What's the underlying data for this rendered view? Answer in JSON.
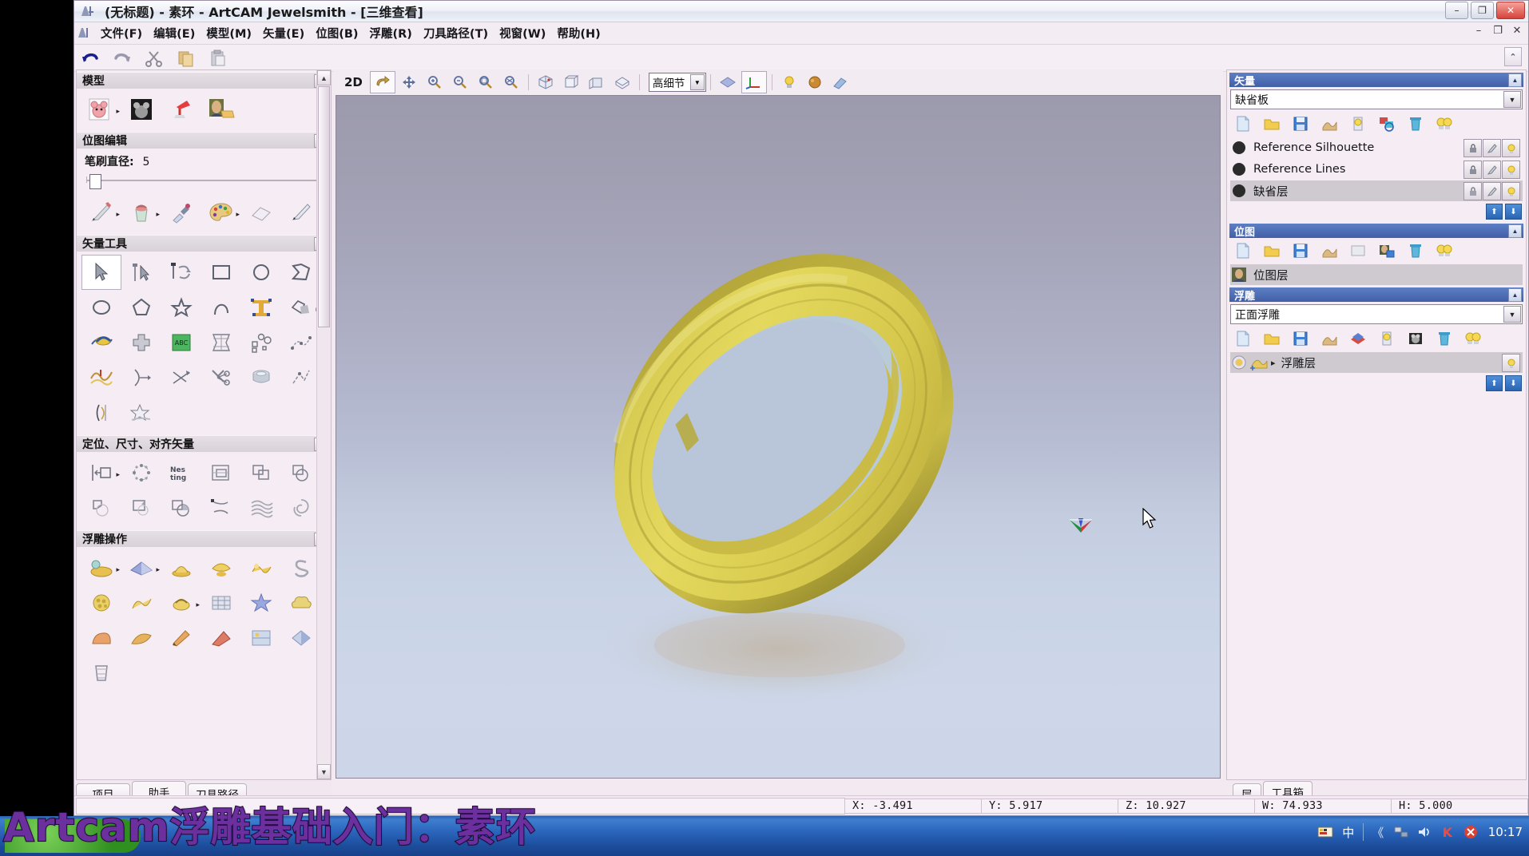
{
  "window": {
    "title": "(无标题) - 素环 - ArtCAM Jewelsmith - [三维查看]",
    "minimize_label": "–",
    "restore_label": "❐",
    "close_label": "✕",
    "mdi_minimize": "–",
    "mdi_restore": "❐",
    "mdi_close": "✕"
  },
  "menu": {
    "items": [
      {
        "label": "文件(F)",
        "name": "menu-file"
      },
      {
        "label": "编辑(E)",
        "name": "menu-edit"
      },
      {
        "label": "模型(M)",
        "name": "menu-model"
      },
      {
        "label": "矢量(E)",
        "name": "menu-vector"
      },
      {
        "label": "位图(B)",
        "name": "menu-bitmap"
      },
      {
        "label": "浮雕(R)",
        "name": "menu-relief"
      },
      {
        "label": "刀具路径(T)",
        "name": "menu-toolpath"
      },
      {
        "label": "视窗(W)",
        "name": "menu-window"
      },
      {
        "label": "帮助(H)",
        "name": "menu-help"
      }
    ]
  },
  "main_toolbar": {
    "items": [
      {
        "name": "undo-icon",
        "glyph": "↶"
      },
      {
        "name": "redo-icon",
        "glyph": "↷"
      },
      {
        "name": "cut-scissors-icon",
        "glyph": "✂"
      },
      {
        "name": "copy-icon",
        "glyph": "❏"
      },
      {
        "name": "paste-icon",
        "glyph": "📋"
      }
    ],
    "collapse_label": "⌃"
  },
  "left_dock": {
    "sections": [
      {
        "title": "模型",
        "name": "section-model",
        "chevron": "▲",
        "tools": [
          {
            "name": "tool-new-model-from-image",
            "glyph": "🧸",
            "has_arrow": true
          },
          {
            "name": "tool-grayscale-model",
            "glyph": "▦",
            "has_arrow": false
          },
          {
            "name": "tool-lamp-light-setup",
            "glyph": "💡",
            "has_arrow": false
          },
          {
            "name": "tool-image-to-relief",
            "glyph": "🖼",
            "has_arrow": false
          }
        ]
      },
      {
        "title": "位图编辑",
        "name": "section-bitmap-edit",
        "chevron": "▲",
        "brush_label": "笔刷直径:",
        "brush_value": "5",
        "tools": [
          {
            "name": "tool-pencil",
            "glyph": "✎",
            "has_arrow": true
          },
          {
            "name": "tool-paint-bucket",
            "glyph": "🪣",
            "has_arrow": true
          },
          {
            "name": "tool-eyedropper",
            "glyph": "💉",
            "has_arrow": false
          },
          {
            "name": "tool-color-palette",
            "glyph": "🎨",
            "has_arrow": true
          },
          {
            "name": "tool-eraser",
            "glyph": "⬭",
            "has_arrow": false
          },
          {
            "name": "tool-pen-draw",
            "glyph": "🖊",
            "has_arrow": false
          }
        ]
      },
      {
        "title": "矢量工具",
        "name": "section-vector-tools",
        "chevron": "▲",
        "tools": [
          {
            "name": "tool-select-arrow",
            "glyph": "➤",
            "selected": true
          },
          {
            "name": "tool-node-edit",
            "glyph": "⤢",
            "has_arrow": false
          },
          {
            "name": "tool-transform",
            "glyph": "✥",
            "has_arrow": false
          },
          {
            "name": "tool-rectangle",
            "glyph": "▭",
            "has_arrow": false
          },
          {
            "name": "tool-ellipse",
            "glyph": "◯",
            "has_arrow": false
          },
          {
            "name": "tool-polyline",
            "glyph": "⌁",
            "has_arrow": false
          },
          {
            "name": "tool-circle",
            "glyph": "◯",
            "has_arrow": false
          },
          {
            "name": "tool-polygon",
            "glyph": "⬠",
            "has_arrow": false
          },
          {
            "name": "tool-star",
            "glyph": "☆",
            "has_arrow": false
          },
          {
            "name": "tool-arc",
            "glyph": "◠",
            "has_arrow": false
          },
          {
            "name": "tool-text",
            "glyph": "T",
            "has_arrow": false
          },
          {
            "name": "tool-vector-merge",
            "glyph": "◣",
            "has_arrow": true
          },
          {
            "name": "tool-text-on-curve",
            "glyph": "〰",
            "has_arrow": false
          },
          {
            "name": "tool-vector-doctor",
            "glyph": "✚",
            "has_arrow": false
          },
          {
            "name": "tool-abc-texture",
            "glyph": "ABC",
            "has_arrow": false
          },
          {
            "name": "tool-distort",
            "glyph": "▤",
            "has_arrow": false
          },
          {
            "name": "tool-nest-shapes",
            "glyph": "⁘",
            "has_arrow": false
          },
          {
            "name": "tool-fit-curve",
            "glyph": "⋰",
            "has_arrow": false
          },
          {
            "name": "tool-vector-smooth",
            "glyph": "〽",
            "has_arrow": false
          },
          {
            "name": "tool-offset-vector",
            "glyph": ")-",
            "has_arrow": false
          },
          {
            "name": "tool-measure",
            "glyph": "〉",
            "has_arrow": false
          },
          {
            "name": "tool-trim-vectors",
            "glyph": "✂",
            "has_arrow": false
          },
          {
            "name": "tool-extrude-ring",
            "glyph": "⬯",
            "has_arrow": false
          },
          {
            "name": "tool-connect-vectors",
            "glyph": "⋋",
            "has_arrow": false
          },
          {
            "name": "tool-ring-sizer",
            "glyph": "◖",
            "has_arrow": false
          },
          {
            "name": "tool-star-cluster",
            "glyph": "✦",
            "has_arrow": false
          }
        ]
      },
      {
        "title": "定位、尺寸、对齐矢量",
        "name": "section-position-size-align",
        "chevron": "▲",
        "tools": [
          {
            "name": "tool-align-left",
            "glyph": "⊢▢",
            "has_arrow": true
          },
          {
            "name": "tool-circular-array",
            "glyph": "◌",
            "has_arrow": false
          },
          {
            "name": "tool-nesting",
            "glyph": "Nesting",
            "has_arrow": false
          },
          {
            "name": "tool-block-copy",
            "glyph": "⊞",
            "has_arrow": false
          },
          {
            "name": "tool-group-vectors",
            "glyph": "❐",
            "has_arrow": false
          },
          {
            "name": "tool-weld-vectors",
            "glyph": "◔",
            "has_arrow": false
          },
          {
            "name": "tool-subtract-vectors",
            "glyph": "◑",
            "has_arrow": false
          },
          {
            "name": "tool-intersect-vectors",
            "glyph": "◪",
            "has_arrow": false
          },
          {
            "name": "tool-combine-vectors",
            "glyph": "◕",
            "has_arrow": false
          },
          {
            "name": "tool-curve-fit",
            "glyph": "〜",
            "has_arrow": false
          },
          {
            "name": "tool-wave-pattern",
            "glyph": "≋",
            "has_arrow": false
          },
          {
            "name": "tool-spiral-pattern",
            "glyph": "◎",
            "has_arrow": false
          }
        ]
      },
      {
        "title": "浮雕操作",
        "name": "section-relief-operations",
        "chevron": "▲",
        "tools": [
          {
            "name": "tool-relief-paste",
            "glyph": "🪄",
            "has_arrow": true
          },
          {
            "name": "tool-relief-plane",
            "glyph": "◆",
            "has_arrow": true
          },
          {
            "name": "tool-relief-shape-editor",
            "glyph": "⛰",
            "has_arrow": false
          },
          {
            "name": "tool-relief-dome",
            "glyph": "🍄",
            "has_arrow": false
          },
          {
            "name": "tool-relief-sculpt",
            "glyph": "✿",
            "has_arrow": false
          },
          {
            "name": "tool-relief-smooth-s",
            "glyph": "S",
            "has_arrow": false
          },
          {
            "name": "tool-relief-texture",
            "glyph": "◍",
            "has_arrow": false
          },
          {
            "name": "tool-relief-extrude",
            "glyph": "⌒",
            "has_arrow": false
          },
          {
            "name": "tool-relief-spin",
            "glyph": "⊙",
            "has_arrow": true
          },
          {
            "name": "tool-relief-weave",
            "glyph": "▣",
            "has_arrow": false
          },
          {
            "name": "tool-relief-star",
            "glyph": "✶",
            "has_arrow": false
          },
          {
            "name": "tool-relief-cloud",
            "glyph": "☁",
            "has_arrow": false
          },
          {
            "name": "tool-relief-fillet",
            "glyph": "◗",
            "has_arrow": false
          },
          {
            "name": "tool-relief-blend",
            "glyph": "◠",
            "has_arrow": false
          },
          {
            "name": "tool-relief-knife",
            "glyph": "🔪",
            "has_arrow": false
          },
          {
            "name": "tool-relief-slice",
            "glyph": "◢",
            "has_arrow": false
          },
          {
            "name": "tool-relief-layers",
            "glyph": "▧",
            "has_arrow": false
          },
          {
            "name": "tool-relief-flip",
            "glyph": "◇",
            "has_arrow": false
          },
          {
            "name": "tool-relief-column",
            "glyph": "⌸",
            "has_arrow": false
          }
        ]
      }
    ],
    "tabs": [
      {
        "label": "项目",
        "name": "tab-project",
        "active": false
      },
      {
        "label": "助手",
        "name": "tab-assistant",
        "active": true
      },
      {
        "label": "刀具路径",
        "name": "tab-toolpath",
        "active": false
      }
    ]
  },
  "viewport_toolbar": {
    "mode_button": "2D",
    "items": [
      {
        "name": "rotate-view-icon",
        "glyph": "↻",
        "selected": true
      },
      {
        "name": "pan-view-icon",
        "glyph": "✥"
      },
      {
        "name": "zoom-in-icon",
        "glyph": "🔍"
      },
      {
        "name": "zoom-out-icon",
        "glyph": "🔍"
      },
      {
        "name": "zoom-window-icon",
        "glyph": "🔍"
      },
      {
        "name": "zoom-fit-icon",
        "glyph": "🔍"
      },
      {
        "name": "iso-view-icon",
        "glyph": "⬡"
      },
      {
        "name": "front-view-icon",
        "glyph": "▢"
      },
      {
        "name": "side-view-icon",
        "glyph": "▢"
      },
      {
        "name": "top-view-icon",
        "glyph": "▱"
      }
    ],
    "detail_value": "高细节",
    "detail_arrow": "▼",
    "right_items": [
      {
        "name": "shade-relief-icon",
        "glyph": "◆"
      },
      {
        "name": "show-axes-icon",
        "glyph": "⊥",
        "selected": true
      },
      {
        "name": "lighting-icon",
        "glyph": "💡"
      },
      {
        "name": "material-icon",
        "glyph": "🟠"
      },
      {
        "name": "clear-view-icon",
        "glyph": "🧹"
      }
    ]
  },
  "viewport": {
    "model_name": "素环",
    "cursor_name": "mouse-pointer",
    "gizmo_name": "axis-gizmo"
  },
  "right_dock": {
    "panels": [
      {
        "title": "矢量",
        "name": "panel-vector",
        "chevron": "▲",
        "combo_value": "缺省板",
        "combo_arrow": "▼",
        "tools": [
          {
            "name": "new-layer-icon",
            "glyph": "📄"
          },
          {
            "name": "open-layer-icon",
            "glyph": "📂"
          },
          {
            "name": "save-layer-icon",
            "glyph": "💾"
          },
          {
            "name": "duplicate-layer-icon",
            "glyph": "🗂"
          },
          {
            "name": "layer-visibility-icon",
            "glyph": "💡"
          },
          {
            "name": "merge-layer-icon",
            "glyph": "🔀"
          },
          {
            "name": "delete-layer-icon",
            "glyph": "🗑"
          },
          {
            "name": "show-all-layers-icon",
            "glyph": "💡"
          }
        ],
        "layers": [
          {
            "label": "Reference Silhouette",
            "name": "layer-reference-silhouette",
            "selected": false
          },
          {
            "label": "Reference Lines",
            "name": "layer-reference-lines",
            "selected": false
          },
          {
            "label": "缺省层",
            "name": "layer-default",
            "selected": true
          }
        ],
        "move_up": "⬆",
        "move_down": "⬇"
      },
      {
        "title": "位图",
        "name": "panel-bitmap",
        "chevron": "▲",
        "tools": [
          {
            "name": "new-bitmap-icon",
            "glyph": "📄"
          },
          {
            "name": "open-bitmap-icon",
            "glyph": "📂"
          },
          {
            "name": "save-bitmap-icon",
            "glyph": "💾"
          },
          {
            "name": "duplicate-bitmap-icon",
            "glyph": "🗂"
          },
          {
            "name": "blank-bitmap-icon",
            "glyph": "▭"
          },
          {
            "name": "bitmap-to-vector-icon",
            "glyph": "🖼"
          },
          {
            "name": "delete-bitmap-icon",
            "glyph": "🗑"
          },
          {
            "name": "show-all-bitmaps-icon",
            "glyph": "💡"
          }
        ],
        "layers": [
          {
            "label": "位图层",
            "name": "layer-bitmap",
            "selected": true
          }
        ]
      },
      {
        "title": "浮雕",
        "name": "panel-relief",
        "chevron": "▲",
        "combo_value": "正面浮雕",
        "combo_arrow": "▼",
        "tools": [
          {
            "name": "new-relief-icon",
            "glyph": "📄"
          },
          {
            "name": "open-relief-icon",
            "glyph": "📂"
          },
          {
            "name": "save-relief-icon",
            "glyph": "💾"
          },
          {
            "name": "duplicate-relief-icon",
            "glyph": "🗂"
          },
          {
            "name": "merge-relief-icon",
            "glyph": "🔶"
          },
          {
            "name": "relief-visibility-icon",
            "glyph": "💡"
          },
          {
            "name": "relief-greyscale-icon",
            "glyph": "▦"
          },
          {
            "name": "delete-relief-icon",
            "glyph": "🗑"
          },
          {
            "name": "show-all-reliefs-icon",
            "glyph": "💡"
          }
        ],
        "layers": [
          {
            "label": "浮雕层",
            "name": "layer-relief",
            "selected": true,
            "expand_arrow": "▸"
          }
        ],
        "move_up": "⬆",
        "move_down": "⬇"
      }
    ],
    "tabs": [
      {
        "label": "层",
        "name": "tab-layers",
        "active": false
      },
      {
        "label": "工具箱",
        "name": "tab-toolbox",
        "active": true
      }
    ]
  },
  "status_bar": {
    "cells": [
      {
        "label": "X:  -3.491",
        "name": "status-x"
      },
      {
        "label": "Y:  5.917",
        "name": "status-y"
      },
      {
        "label": "Z:  10.927",
        "name": "status-z"
      },
      {
        "label": "W:  74.933",
        "name": "status-w"
      },
      {
        "label": "H:  5.000",
        "name": "status-h"
      }
    ]
  },
  "taskbar": {
    "tray": [
      {
        "name": "ime-keyboard-icon",
        "glyph": "⌨"
      },
      {
        "name": "ime-chinese-icon",
        "glyph": "中"
      },
      {
        "name": "show-hidden-icons-icon",
        "glyph": "《"
      },
      {
        "name": "network-icon",
        "glyph": "🖧"
      },
      {
        "name": "volume-icon",
        "glyph": "🔊"
      },
      {
        "name": "kingsoft-icon",
        "glyph": "K"
      },
      {
        "name": "antivirus-icon",
        "glyph": "✕"
      }
    ],
    "clock": "10:17"
  },
  "overlay": {
    "caption": "Artcam浮雕基础入门：素环"
  },
  "colors": {
    "title_accent": "#415fa8",
    "panel_bg": "#f6ecf4",
    "ring_gold": "#ddd14b",
    "taskbar_blue": "#2a65bb",
    "caption_purple": "#6b2f9e"
  }
}
